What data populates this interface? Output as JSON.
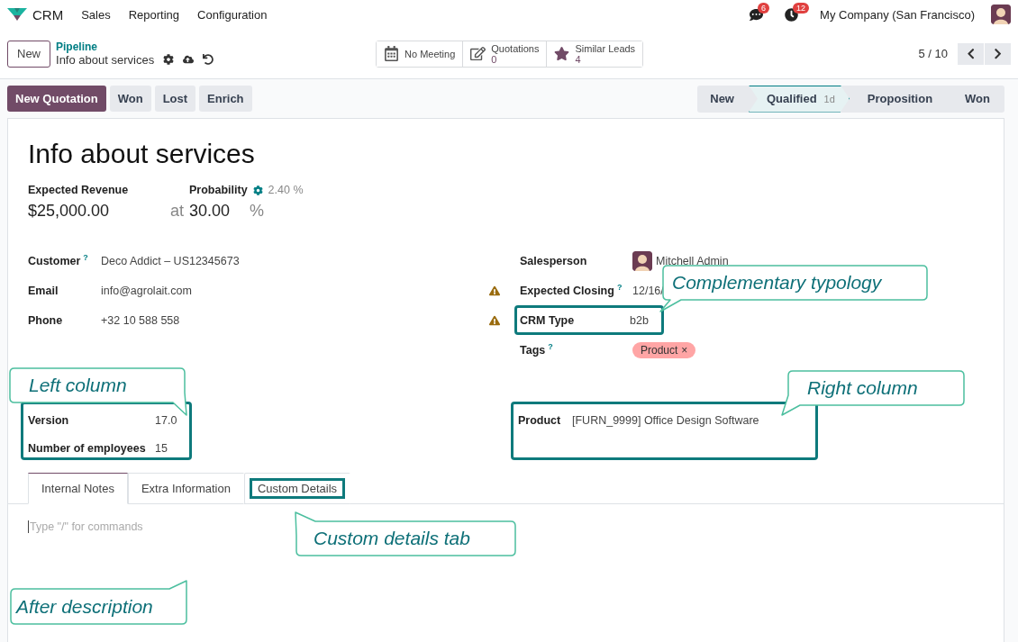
{
  "navbar": {
    "app": "CRM",
    "menus": [
      "Sales",
      "Reporting",
      "Configuration"
    ],
    "messages_count": "6",
    "activities_count": "12",
    "company": "My Company (San Francisco)"
  },
  "control_panel": {
    "new_button": "New",
    "breadcrumb": "Pipeline",
    "record_title": "Info about services",
    "pager": "5 / 10",
    "smart_buttons": [
      {
        "kind": "calendar",
        "label": "No Meeting"
      },
      {
        "kind": "edit",
        "label": "Quotations",
        "value": "0"
      },
      {
        "kind": "star",
        "label": "Similar Leads",
        "value": "4"
      }
    ]
  },
  "actions": [
    {
      "label": "New Quotation",
      "primary": true
    },
    {
      "label": "Won",
      "primary": false
    },
    {
      "label": "Lost",
      "primary": false
    },
    {
      "label": "Enrich",
      "primary": false
    }
  ],
  "stages": [
    {
      "label": "New",
      "selected": false
    },
    {
      "label": "Qualified",
      "duration": "1d",
      "selected": true
    },
    {
      "label": "Proposition",
      "selected": false
    },
    {
      "label": "Won",
      "selected": false
    }
  ],
  "form": {
    "title": "Info about services",
    "revenue_label": "Expected Revenue",
    "revenue": "$25,000.00",
    "at": "at",
    "probability_label": "Probability",
    "probability_auto": "2.40 %",
    "probability": "30.00",
    "percent": "%",
    "left_fields": [
      {
        "label": "Customer",
        "help": "?",
        "value": "Deco Addict – US12345673",
        "warning": false
      },
      {
        "label": "Email",
        "value": "info@agrolait.com",
        "warning": true
      },
      {
        "label": "Phone",
        "value": "+32 10 588 558",
        "warning": true
      }
    ],
    "right_fields": [
      {
        "kind": "user",
        "label": "Salesperson",
        "value": "Mitchell Admin",
        "highlighted": false
      },
      {
        "kind": "text",
        "label": "Expected Closing",
        "help": "?",
        "value": "12/16/",
        "highlighted": false
      },
      {
        "kind": "text",
        "label": "CRM Type",
        "value": "b2b",
        "highlighted": true
      },
      {
        "kind": "tags",
        "label": "Tags",
        "help": "?",
        "highlighted": false,
        "tags": [
          {
            "label": "Product",
            "remove": "×"
          }
        ]
      }
    ],
    "custom_left": [
      {
        "label": "Version",
        "value": "17.0"
      },
      {
        "label": "Number of employees",
        "value": "15"
      }
    ],
    "custom_right": [
      {
        "label": "Product",
        "value": "[FURN_9999] Office Design Software"
      }
    ],
    "tabs": [
      {
        "label": "Internal Notes",
        "selected": true,
        "highlighted": false
      },
      {
        "label": "Extra Information",
        "selected": false,
        "highlighted": false
      },
      {
        "label": "Custom Details",
        "selected": false,
        "highlighted": true
      }
    ],
    "notes_placeholder": "Type \"/\" for commands"
  },
  "callouts": [
    {
      "text": "Complementary typology"
    },
    {
      "text": "Left column"
    },
    {
      "text": "Right column"
    },
    {
      "text": "Custom details tab"
    },
    {
      "text": "After description"
    }
  ]
}
